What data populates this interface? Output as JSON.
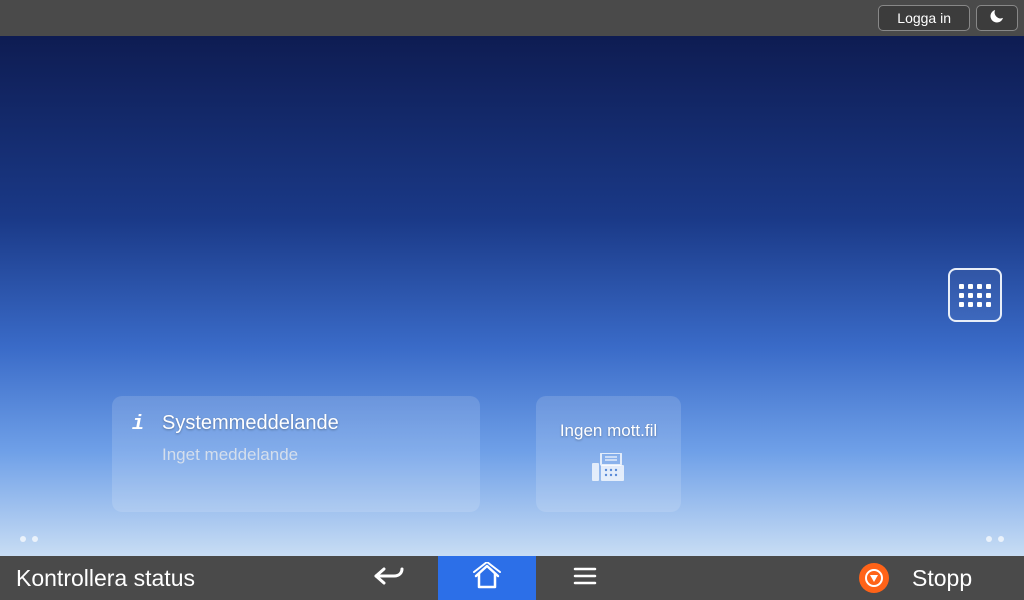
{
  "topBar": {
    "loginLabel": "Logga in"
  },
  "widgets": {
    "systemMessage": {
      "title": "Systemmeddelande",
      "subtitle": "Inget meddelande"
    },
    "receivedFiles": {
      "label": "Ingen mott.fil"
    }
  },
  "bottomBar": {
    "statusLabel": "Kontrollera status",
    "stopLabel": "Stopp"
  }
}
